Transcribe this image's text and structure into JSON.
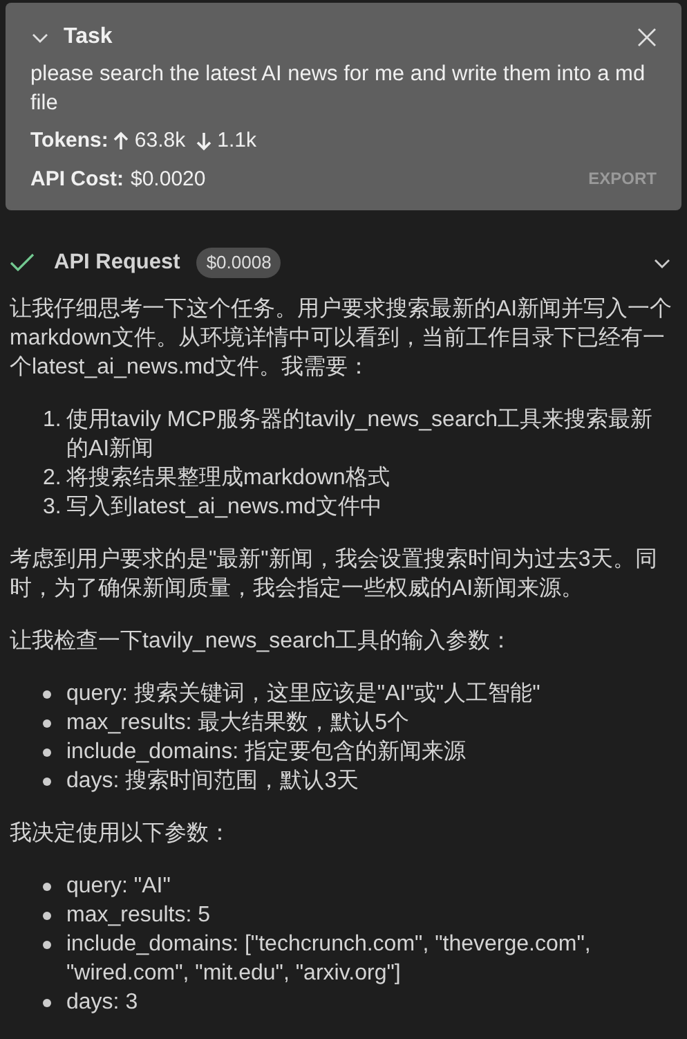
{
  "task": {
    "title": "Task",
    "expanded": true,
    "text": "please search the latest AI news for me and write them into a md file",
    "tokens_label": "Tokens:",
    "tokens_in": "63.8k",
    "tokens_out": "1.1k",
    "cost_label": "API Cost:",
    "cost": "$0.0020",
    "export": "EXPORT"
  },
  "api_request": {
    "title": "API Request",
    "cost": "$0.0008",
    "done": true,
    "expanded": false
  },
  "content": [
    {
      "kind": "paragraph",
      "text": "让我仔细思考一下这个任务。用户要求搜索最新的AI新闻并写入一个markdown文件。从环境详情中可以看到，当前工作目录下已经有一个latest_ai_news.md文件。我需要："
    },
    {
      "kind": "ordered",
      "items": [
        {
          "number": "1.",
          "text": "使用tavily MCP服务器的tavily_news_search工具来搜索最新的AI新闻"
        },
        {
          "number": "2.",
          "text": "将搜索结果整理成markdown格式"
        },
        {
          "number": "3.",
          "text": "写入到latest_ai_news.md文件中"
        }
      ]
    },
    {
      "kind": "paragraph",
      "text": "考虑到用户要求的是\"最新\"新闻，我会设置搜索时间为过去3天。同时，为了确保新闻质量，我会指定一些权威的AI新闻来源。"
    },
    {
      "kind": "paragraph",
      "text": "让我检查一下tavily_news_search工具的输入参数："
    },
    {
      "kind": "bullets",
      "items": [
        "query: 搜索关键词，这里应该是\"AI\"或\"人工智能\"",
        "max_results: 最大结果数，默认5个",
        "include_domains: 指定要包含的新闻来源",
        "days: 搜索时间范围，默认3天"
      ]
    },
    {
      "kind": "paragraph",
      "text": "我决定使用以下参数："
    },
    {
      "kind": "bullets",
      "items": [
        "query: \"AI\"",
        "max_results: 5",
        "include_domains: [\"techcrunch.com\", \"theverge.com\", \"wired.com\", \"mit.edu\", \"arxiv.org\"]",
        "days: 3"
      ]
    }
  ]
}
